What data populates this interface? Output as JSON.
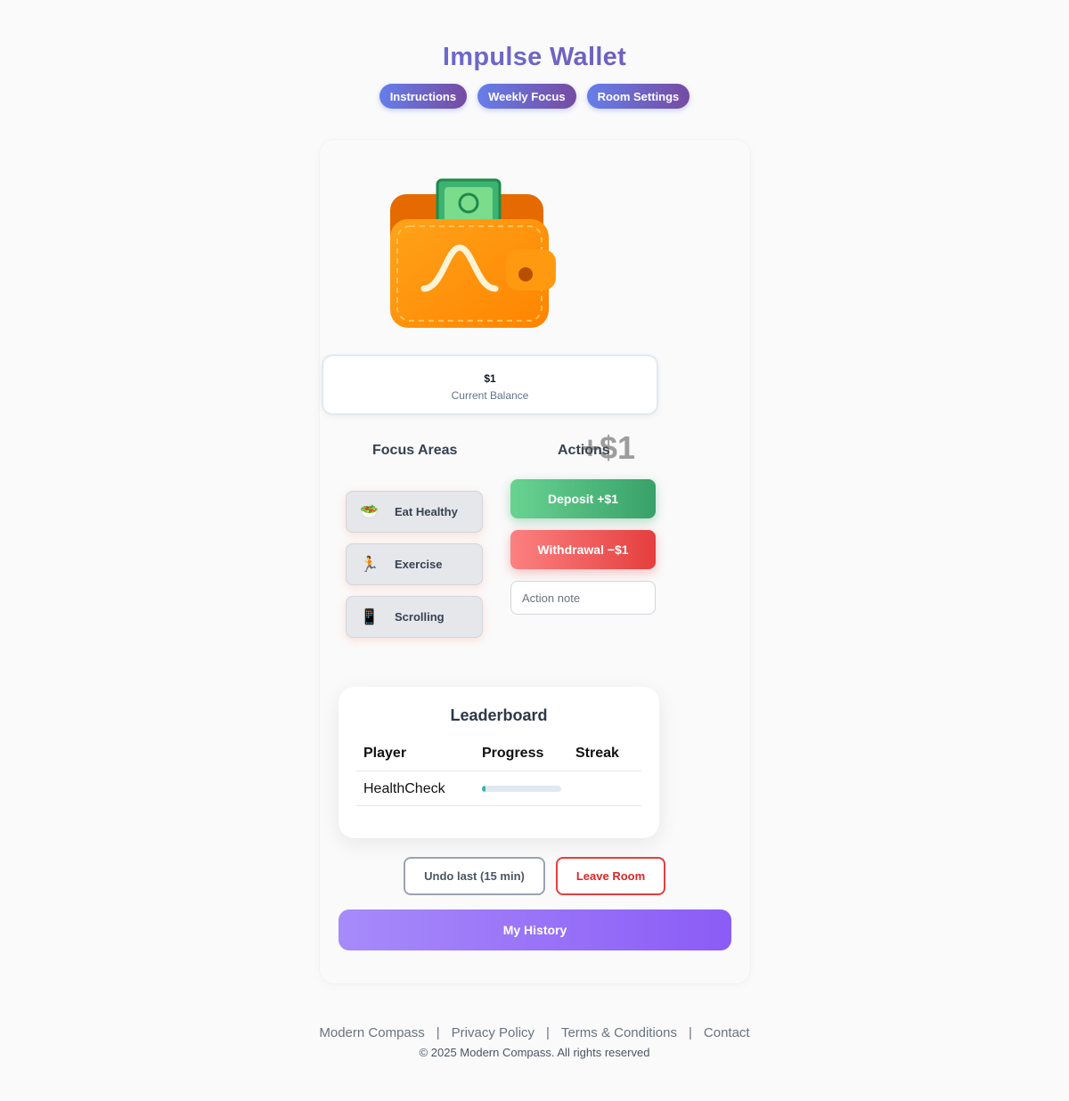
{
  "app": {
    "title": "Impulse Wallet"
  },
  "topnav": {
    "items": [
      "Instructions",
      "Weekly Focus",
      "Room Settings"
    ]
  },
  "balance": {
    "amount": "$1",
    "label": "Current Balance"
  },
  "focus": {
    "heading": "Focus Areas",
    "items": [
      {
        "icon": "🥗",
        "icon_name": "salad-icon",
        "label": "Eat Healthy"
      },
      {
        "icon": "🏃",
        "icon_name": "running-icon",
        "label": "Exercise"
      },
      {
        "icon": "📱",
        "icon_name": "phone-icon",
        "label": "Scrolling"
      }
    ]
  },
  "actions": {
    "heading": "Actions",
    "floating_amount": "+$1",
    "deposit_label": "Deposit +$1",
    "withdraw_label": "Withdrawal −$1",
    "note_placeholder": "Action note"
  },
  "leaderboard": {
    "title": "Leaderboard",
    "columns": [
      "Player",
      "Progress",
      "Streak"
    ],
    "rows": [
      {
        "player": "HealthCheck",
        "progress": 0.05,
        "streak": ""
      }
    ]
  },
  "controls": {
    "undo_label": "Undo last (15 min)",
    "leave_label": "Leave Room",
    "history_label": "My History"
  },
  "footer": {
    "links": [
      "Modern Compass",
      "Privacy Policy",
      "Terms & Conditions",
      "Contact"
    ],
    "separator": "|",
    "copyright": "© 2025 Modern Compass. All rights reserved"
  },
  "colors": {
    "brand_gradient_start": "#667eea",
    "brand_gradient_end": "#764ba2",
    "deposit": "#38a169",
    "withdraw": "#e53e3e",
    "history": "#8b5cf6",
    "wallet_orange": "#ff8c00"
  }
}
